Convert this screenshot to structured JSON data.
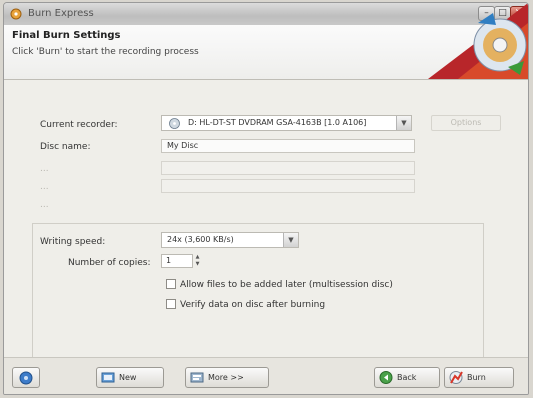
{
  "window": {
    "title": "Burn Express",
    "controls": {
      "minimize": "–",
      "maximize": "□",
      "close": "✕"
    }
  },
  "header": {
    "title": "Final Burn Settings",
    "subtitle": "Click 'Burn' to start the recording process"
  },
  "form": {
    "current_recorder": {
      "label": "Current recorder:",
      "value": "D: HL-DT-ST DVDRAM GSA-4163B [1.0 A106]",
      "icon": "disc-drive-icon"
    },
    "options_button": "Options",
    "disc_name": {
      "label": "Disc name:",
      "value": "My Disc"
    },
    "disabled_row1": {
      "label": "...",
      "value": ""
    },
    "disabled_row2": {
      "label": "...",
      "value": ""
    },
    "disabled_row3": {
      "label": "...",
      "value": ""
    },
    "writing_speed": {
      "label": "Writing speed:",
      "value": "24x (3,600 KB/s)"
    },
    "number_of_copies": {
      "label": "Number of copies:",
      "value": "1"
    },
    "allow_files_later": {
      "label": "Allow files to be added later (multisession disc)",
      "checked": false
    },
    "verify_data": {
      "label": "Verify data on disc after burning",
      "checked": false
    }
  },
  "footer": {
    "new_label": "New",
    "more_label": "More >>",
    "back_label": "Back",
    "burn_label": "Burn"
  }
}
